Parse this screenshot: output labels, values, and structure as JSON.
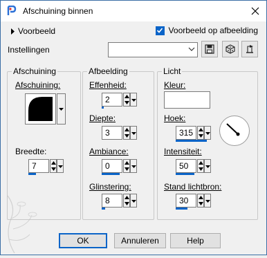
{
  "window": {
    "title": "Afschuining binnen"
  },
  "preview": {
    "toggle_label": "Voorbeeld",
    "checkbox_label": "Voorbeeld op afbeelding",
    "checked": true
  },
  "settings": {
    "label": "Instellingen",
    "select_value": ""
  },
  "groups": {
    "bevel": {
      "title": "Afschuining",
      "bevel_label": "Afschuining:",
      "width_label": "Breedte:",
      "width_value": "7"
    },
    "image": {
      "title": "Afbeelding",
      "smoothness_label": "Effenheid:",
      "smoothness_value": "2",
      "depth_label": "Diepte:",
      "depth_value": "3",
      "ambience_label": "Ambiance:",
      "ambience_value": "0",
      "shininess_label": "Glinstering:",
      "shininess_value": "8"
    },
    "light": {
      "title": "Licht",
      "color_label": "Kleur:",
      "angle_label": "Hoek:",
      "angle_value": "315",
      "intensity_label": "Intensiteit:",
      "intensity_value": "50",
      "elevation_label": "Stand lichtbron:",
      "elevation_value": "30"
    }
  },
  "buttons": {
    "ok": "OK",
    "cancel": "Annuleren",
    "help": "Help"
  },
  "colors": {
    "accent": "#0a64c8",
    "light_color": "#ffffff"
  }
}
